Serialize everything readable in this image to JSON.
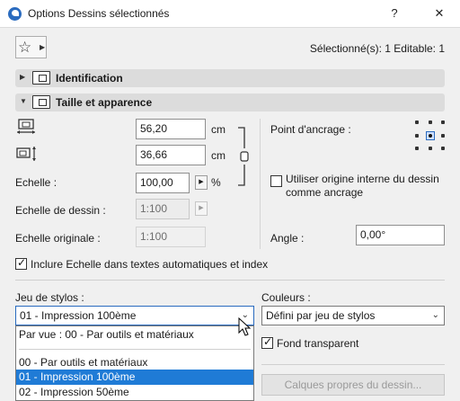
{
  "window": {
    "title": "Options Dessins sélectionnés",
    "help_label": "?",
    "close_label": "✕"
  },
  "toolbar": {
    "favorites_icon": "star-icon",
    "selection_info": "Sélectionné(s): 1 Editable: 1"
  },
  "sections": {
    "identification": "Identification",
    "size_appearance": "Taille et apparence"
  },
  "size": {
    "width_value": "56,20",
    "width_unit": "cm",
    "height_value": "36,66",
    "height_unit": "cm",
    "scale_label": "Echelle :",
    "scale_value": "100,00",
    "scale_unit": "%",
    "drawing_scale_label": "Echelle de dessin :",
    "drawing_scale_value": "1:100",
    "original_scale_label": "Echelle originale :",
    "original_scale_value": "1:100",
    "anchor_label": "Point d'ancrage :",
    "use_origin_label": "Utiliser origine interne du dessin comme ancrage",
    "use_origin_checked": false,
    "angle_label": "Angle :",
    "angle_value": "0,00°",
    "include_scale_label": "Inclure Echelle dans textes automatiques et index",
    "include_scale_checked": true
  },
  "pens": {
    "label": "Jeu de stylos :",
    "selected": "01 - Impression 100ème",
    "options": [
      "Par vue : 00 - Par outils et matériaux",
      "00 - Par outils et matériaux",
      "01 - Impression 100ème",
      "02 - Impression 50ème"
    ],
    "highlighted_index": 2
  },
  "colors": {
    "label": "Couleurs :",
    "selected": "Défini par jeu de stylos",
    "transparent_label": "Fond transparent",
    "transparent_checked": true,
    "layers_button": "Calques propres du dessin..."
  }
}
